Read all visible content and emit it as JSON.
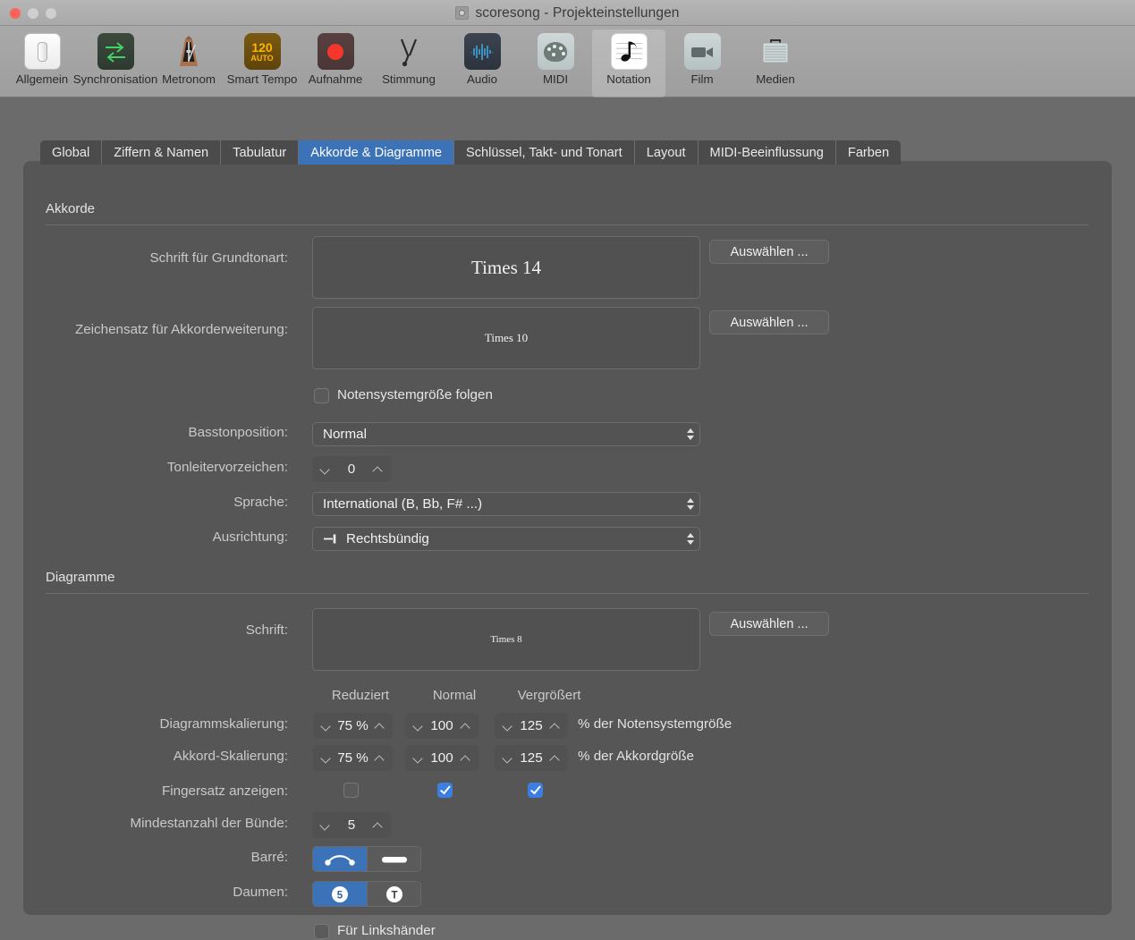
{
  "window": {
    "title": "scoresong - Projekteinstellungen",
    "controls": {
      "close": "close-button",
      "minimize": "minimize-button",
      "zoom": "zoom-button"
    }
  },
  "toolbar": {
    "items": [
      {
        "label": "Allgemein",
        "icon": "toggle-switch-icon",
        "selected": false
      },
      {
        "label": "Synchronisation",
        "icon": "sync-arrows-icon",
        "selected": false
      },
      {
        "label": "Metronom",
        "icon": "metronome-icon",
        "selected": false
      },
      {
        "label": "Smart Tempo",
        "icon": "tempo-120-auto-icon",
        "selected": false,
        "badge_top": "120",
        "badge_bottom": "AUTO"
      },
      {
        "label": "Aufnahme",
        "icon": "record-dot-icon",
        "selected": false
      },
      {
        "label": "Stimmung",
        "icon": "tuning-fork-icon",
        "selected": false
      },
      {
        "label": "Audio",
        "icon": "waveform-icon",
        "selected": false
      },
      {
        "label": "MIDI",
        "icon": "midi-palette-icon",
        "selected": false
      },
      {
        "label": "Notation",
        "icon": "music-note-page-icon",
        "selected": true
      },
      {
        "label": "Film",
        "icon": "video-camera-icon",
        "selected": false
      },
      {
        "label": "Medien",
        "icon": "briefcase-icon",
        "selected": false
      }
    ]
  },
  "tabs": [
    {
      "label": "Global",
      "active": false
    },
    {
      "label": "Ziffern & Namen",
      "active": false
    },
    {
      "label": "Tabulatur",
      "active": false
    },
    {
      "label": "Akkorde & Diagramme",
      "active": true
    },
    {
      "label": "Schlüssel, Takt- und Tonart",
      "active": false
    },
    {
      "label": "Layout",
      "active": false
    },
    {
      "label": "MIDI-Beeinflussung",
      "active": false
    },
    {
      "label": "Farben",
      "active": false
    }
  ],
  "akkorde": {
    "section_title": "Akkorde",
    "root_font": {
      "label": "Schrift für Grundtonart:",
      "value": "Times 14",
      "button": "Auswählen ..."
    },
    "extension_font": {
      "label": "Zeichensatz für Akkorderweiterung:",
      "value": "Times 10",
      "button": "Auswählen ..."
    },
    "follow_staff_size": {
      "label": "Notensystemgröße folgen",
      "checked": false
    },
    "bass_position": {
      "label": "Basstonposition:",
      "value": "Normal"
    },
    "scale_accidentals": {
      "label": "Tonleitervorzeichen:",
      "value": "0"
    },
    "language": {
      "label": "Sprache:",
      "value": "International (B, Bb, F# ...)"
    },
    "alignment": {
      "label": "Ausrichtung:",
      "value": "Rechtsbündig",
      "glyph": "right-align-icon"
    }
  },
  "diagramme": {
    "section_title": "Diagramme",
    "font": {
      "label": "Schrift:",
      "value": "Times 8",
      "button": "Auswählen ..."
    },
    "columns": [
      "Reduziert",
      "Normal",
      "Vergrößert"
    ],
    "diagram_scaling": {
      "label": "Diagrammskalierung:",
      "values": [
        "75 %",
        "100",
        "125"
      ],
      "unit": "% der Notensystemgröße"
    },
    "chord_scaling": {
      "label": "Akkord-Skalierung:",
      "values": [
        "75 %",
        "100",
        "125"
      ],
      "unit": "% der Akkordgröße"
    },
    "show_fingering": {
      "label": "Fingersatz anzeigen:",
      "checked": [
        false,
        true,
        true
      ]
    },
    "min_frets": {
      "label": "Mindestanzahl der Bünde:",
      "value": "5"
    },
    "barre": {
      "label": "Barré:",
      "options": [
        "arc-slur-icon",
        "thick-bar-icon"
      ],
      "selected": 0
    },
    "thumb": {
      "label": "Daumen:",
      "options": [
        "circled-5-icon",
        "circled-t-icon"
      ],
      "selected": 0
    },
    "left_handed": {
      "label": "Für Linkshänder",
      "checked": false
    }
  },
  "colors": {
    "accent_blue": "#3c72b8",
    "checkbox_blue": "#3b80e0",
    "panel_bg": "#565656",
    "window_bg": "#6b6b6b",
    "titlebar_bg": "#ababab",
    "close_red": "#ff6259"
  }
}
